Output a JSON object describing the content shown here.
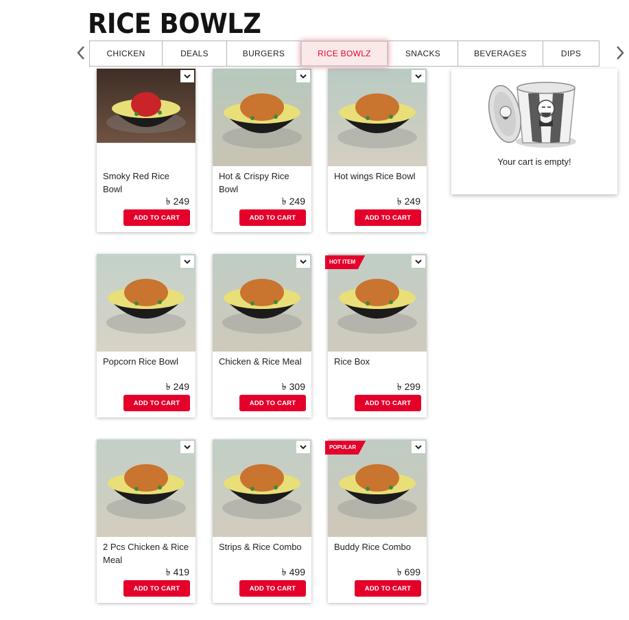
{
  "header": {
    "title": "RICE BOWLZ"
  },
  "tabs": [
    {
      "label": "CHICKEN",
      "active": false
    },
    {
      "label": "DEALS",
      "active": false
    },
    {
      "label": "BURGERS",
      "active": false
    },
    {
      "label": "RICE BOWLZ",
      "active": true
    },
    {
      "label": "SNACKS",
      "active": false
    },
    {
      "label": "BEVERAGES",
      "active": false
    },
    {
      "label": "DIPS",
      "active": false
    }
  ],
  "nav": {
    "prev_icon": "chevron-left-icon",
    "next_icon": "chevron-right-icon"
  },
  "cart": {
    "empty_text": "Your cart is empty!",
    "icon": "kfc-bucket-icon"
  },
  "products": [
    {
      "name": "Smoky Red Rice Bowl",
      "price": "249",
      "currency": "৳",
      "button": "ADD TO CART",
      "badge": ""
    },
    {
      "name": "Hot & Crispy Rice Bowl",
      "price": "249",
      "currency": "৳",
      "button": "ADD TO CART",
      "badge": ""
    },
    {
      "name": "Hot wings Rice Bowl",
      "price": "249",
      "currency": "৳",
      "button": "ADD TO CART",
      "badge": ""
    },
    {
      "name": "Popcorn Rice Bowl",
      "price": "249",
      "currency": "৳",
      "button": "ADD TO CART",
      "badge": ""
    },
    {
      "name": "Chicken & Rice Meal",
      "price": "309",
      "currency": "৳",
      "button": "ADD TO CART",
      "badge": ""
    },
    {
      "name": "Rice Box",
      "price": "299",
      "currency": "৳",
      "button": "ADD TO CART",
      "badge": "HOT ITEM"
    },
    {
      "name": "2 Pcs Chicken & Rice Meal",
      "price": "419",
      "currency": "৳",
      "button": "ADD TO CART",
      "badge": ""
    },
    {
      "name": "Strips & Rice Combo",
      "price": "499",
      "currency": "৳",
      "button": "ADD TO CART",
      "badge": ""
    },
    {
      "name": "Buddy Rice Combo",
      "price": "699",
      "currency": "৳",
      "button": "ADD TO CART",
      "badge": "POPULAR"
    }
  ],
  "colors": {
    "brand_red": "#e4002b",
    "text": "#1a1a1a",
    "tab_active_bg": "#fbe9e9"
  }
}
